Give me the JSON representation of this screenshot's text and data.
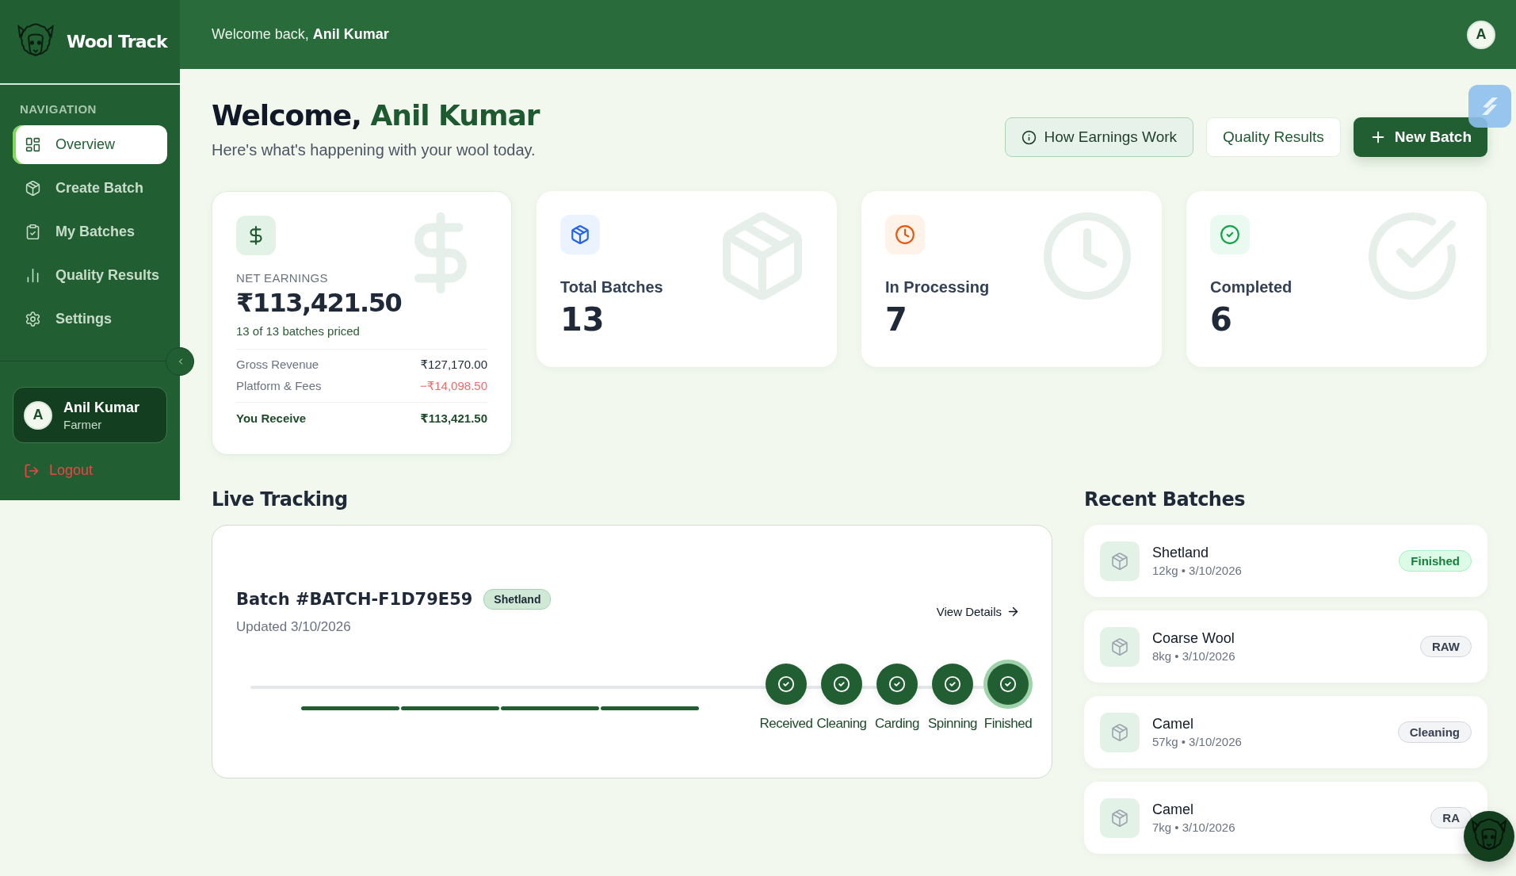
{
  "brand": {
    "name": "Wool Track"
  },
  "sidebar": {
    "heading": "NAVIGATION",
    "items": [
      {
        "label": "Overview",
        "kind": "grid",
        "selected": true
      },
      {
        "label": "Create Batch",
        "kind": "box",
        "selected": false
      },
      {
        "label": "My Batches",
        "kind": "clipboard",
        "selected": false
      },
      {
        "label": "Quality Results",
        "kind": "chart",
        "selected": false
      },
      {
        "label": "Settings",
        "kind": "gear",
        "selected": false
      }
    ],
    "user": {
      "initial": "A",
      "name": "Anil Kumar",
      "role": "Farmer"
    },
    "logout": "Logout"
  },
  "header": {
    "greeting": "Welcome back, **Anil Kumar**",
    "avatar": "A"
  },
  "page": {
    "title_prefix": "Welcome, ",
    "title_name": "Anil Kumar",
    "subtitle": "Here's what's happening with your wool today.",
    "buttons": [
      {
        "label": "How Earnings Work",
        "kind": "info"
      },
      {
        "label": "Quality Results",
        "kind": "outline"
      },
      {
        "label": "New Batch",
        "kind": "primary"
      }
    ]
  },
  "earnings": {
    "label": "NET EARNINGS",
    "amount": "₹113,421.50",
    "note": "13 of 13 batches priced",
    "rows": [
      {
        "label": "Gross Revenue",
        "value": "₹127,170.00",
        "kind": "plain"
      },
      {
        "label": "Platform & Fees",
        "value": "−₹14,098.50",
        "kind": "negative"
      },
      {
        "label": "You Receive",
        "value": "₹113,421.50",
        "kind": "total"
      }
    ]
  },
  "stats": [
    {
      "label": "Total Batches",
      "value": "13",
      "kind": "box"
    },
    {
      "label": "In Processing",
      "value": "7",
      "kind": "clock"
    },
    {
      "label": "Completed",
      "value": "6",
      "kind": "check"
    }
  ],
  "live_tracking": {
    "heading": "Live Tracking",
    "batch": "Batch #BATCH-F1D79E59",
    "tag": "Shetland",
    "updated": "Updated 3/10/2026",
    "link": "View Details",
    "steps": [
      {
        "label": "Received",
        "done": true,
        "selected": false
      },
      {
        "label": "Cleaning",
        "done": true,
        "selected": false
      },
      {
        "label": "Carding",
        "done": true,
        "selected": false
      },
      {
        "label": "Spinning",
        "done": true,
        "selected": false
      },
      {
        "label": "Finished",
        "done": true,
        "selected": true
      }
    ]
  },
  "recent_batches": {
    "heading": "Recent Batches",
    "items": [
      {
        "name": "Shetland",
        "meta": "12kg • 3/10/2026",
        "status": "Finished",
        "kind": "finished"
      },
      {
        "name": "Coarse Wool",
        "meta": "8kg • 3/10/2026",
        "status": "RAW",
        "kind": "neutral"
      },
      {
        "name": "Camel",
        "meta": "57kg • 3/10/2026",
        "status": "Cleaning",
        "kind": "neutral"
      },
      {
        "name": "Camel",
        "meta": "7kg • 3/10/2026",
        "status": "RA",
        "kind": "neutral"
      }
    ]
  }
}
